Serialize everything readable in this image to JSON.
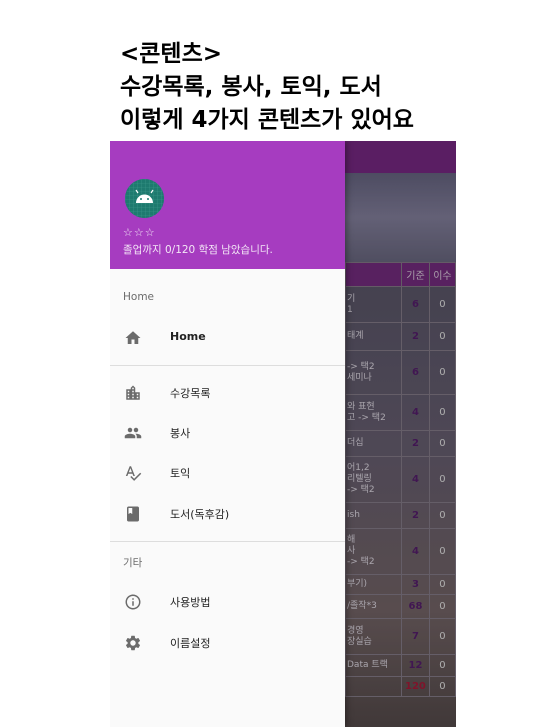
{
  "caption": {
    "line1": "<콘텐츠>",
    "line2": "수강목록, 봉사, 토익, 도서",
    "line3": "이렇게 4가지 콘텐츠가 있어요"
  },
  "drawer": {
    "stars": "☆☆☆",
    "graduation_text": "졸업까지 0/120 학점 남았습니다.",
    "section_home": "Home",
    "home_label": "Home",
    "items": [
      {
        "label": "수강목록",
        "icon": "building-icon"
      },
      {
        "label": "봉사",
        "icon": "people-icon"
      },
      {
        "label": "토익",
        "icon": "spellcheck-icon"
      },
      {
        "label": "도서(독후감)",
        "icon": "book-icon"
      }
    ],
    "section_other": "기타",
    "other_items": [
      {
        "label": "사용방법",
        "icon": "info-icon"
      },
      {
        "label": "이름설정",
        "icon": "gear-icon"
      }
    ],
    "accent": "#a63cc0"
  },
  "background_table": {
    "headers": [
      "",
      "기준",
      "이수"
    ],
    "rows": [
      {
        "name": "기\n1",
        "std": "6",
        "done": "0"
      },
      {
        "name": "태계",
        "std": "2",
        "done": "0"
      },
      {
        "name": "-> 택2\n세미나",
        "std": "6",
        "done": "0"
      },
      {
        "name": "와 표현\n고 -> 택2",
        "std": "4",
        "done": "0"
      },
      {
        "name": "더십",
        "std": "2",
        "done": "0"
      },
      {
        "name": "어1,2\n리텔링\n-> 택2",
        "std": "4",
        "done": "0"
      },
      {
        "name": "ish",
        "std": "2",
        "done": "0"
      },
      {
        "name": "해\n사\n-> 택2",
        "std": "4",
        "done": "0"
      },
      {
        "name": "부기)",
        "std": "3",
        "done": "0"
      },
      {
        "name": "/졸작*3",
        "std": "68",
        "done": "0"
      },
      {
        "name": "경영\n장실습",
        "std": "7",
        "done": "0"
      },
      {
        "name": "Data 트랙",
        "std": "12",
        "done": "0"
      },
      {
        "name": "",
        "std": "120",
        "done": "0"
      }
    ]
  }
}
